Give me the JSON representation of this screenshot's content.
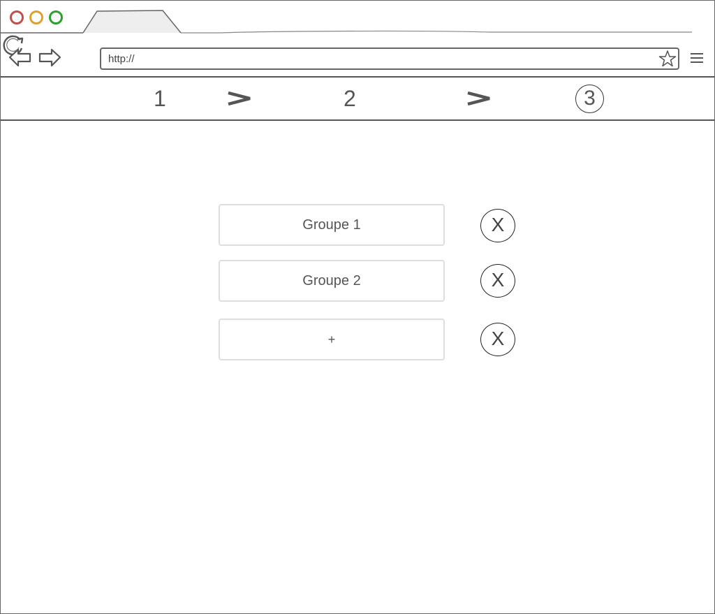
{
  "browser": {
    "address_bar": {
      "value": "http://"
    },
    "icons": [
      "back-arrow-icon",
      "forward-arrow-icon",
      "reload-icon",
      "star-icon",
      "menu-icon"
    ]
  },
  "stepper": {
    "steps": [
      {
        "label": "1",
        "state": "inactive"
      },
      {
        "label": "2",
        "state": "inactive"
      },
      {
        "label": "3",
        "state": "active"
      }
    ],
    "separator_icon": "chevron-right-icon"
  },
  "groups": {
    "items": [
      {
        "label": "Groupe 1",
        "delete_label": "X"
      },
      {
        "label": "Groupe 2",
        "delete_label": "X"
      },
      {
        "label": "+",
        "delete_label": "X"
      }
    ]
  },
  "colors": {
    "traffic_red": "#c0504d",
    "traffic_orange": "#e0a030",
    "traffic_green": "#2ca02c",
    "button_border": "#dddddd",
    "text": "#555555"
  }
}
